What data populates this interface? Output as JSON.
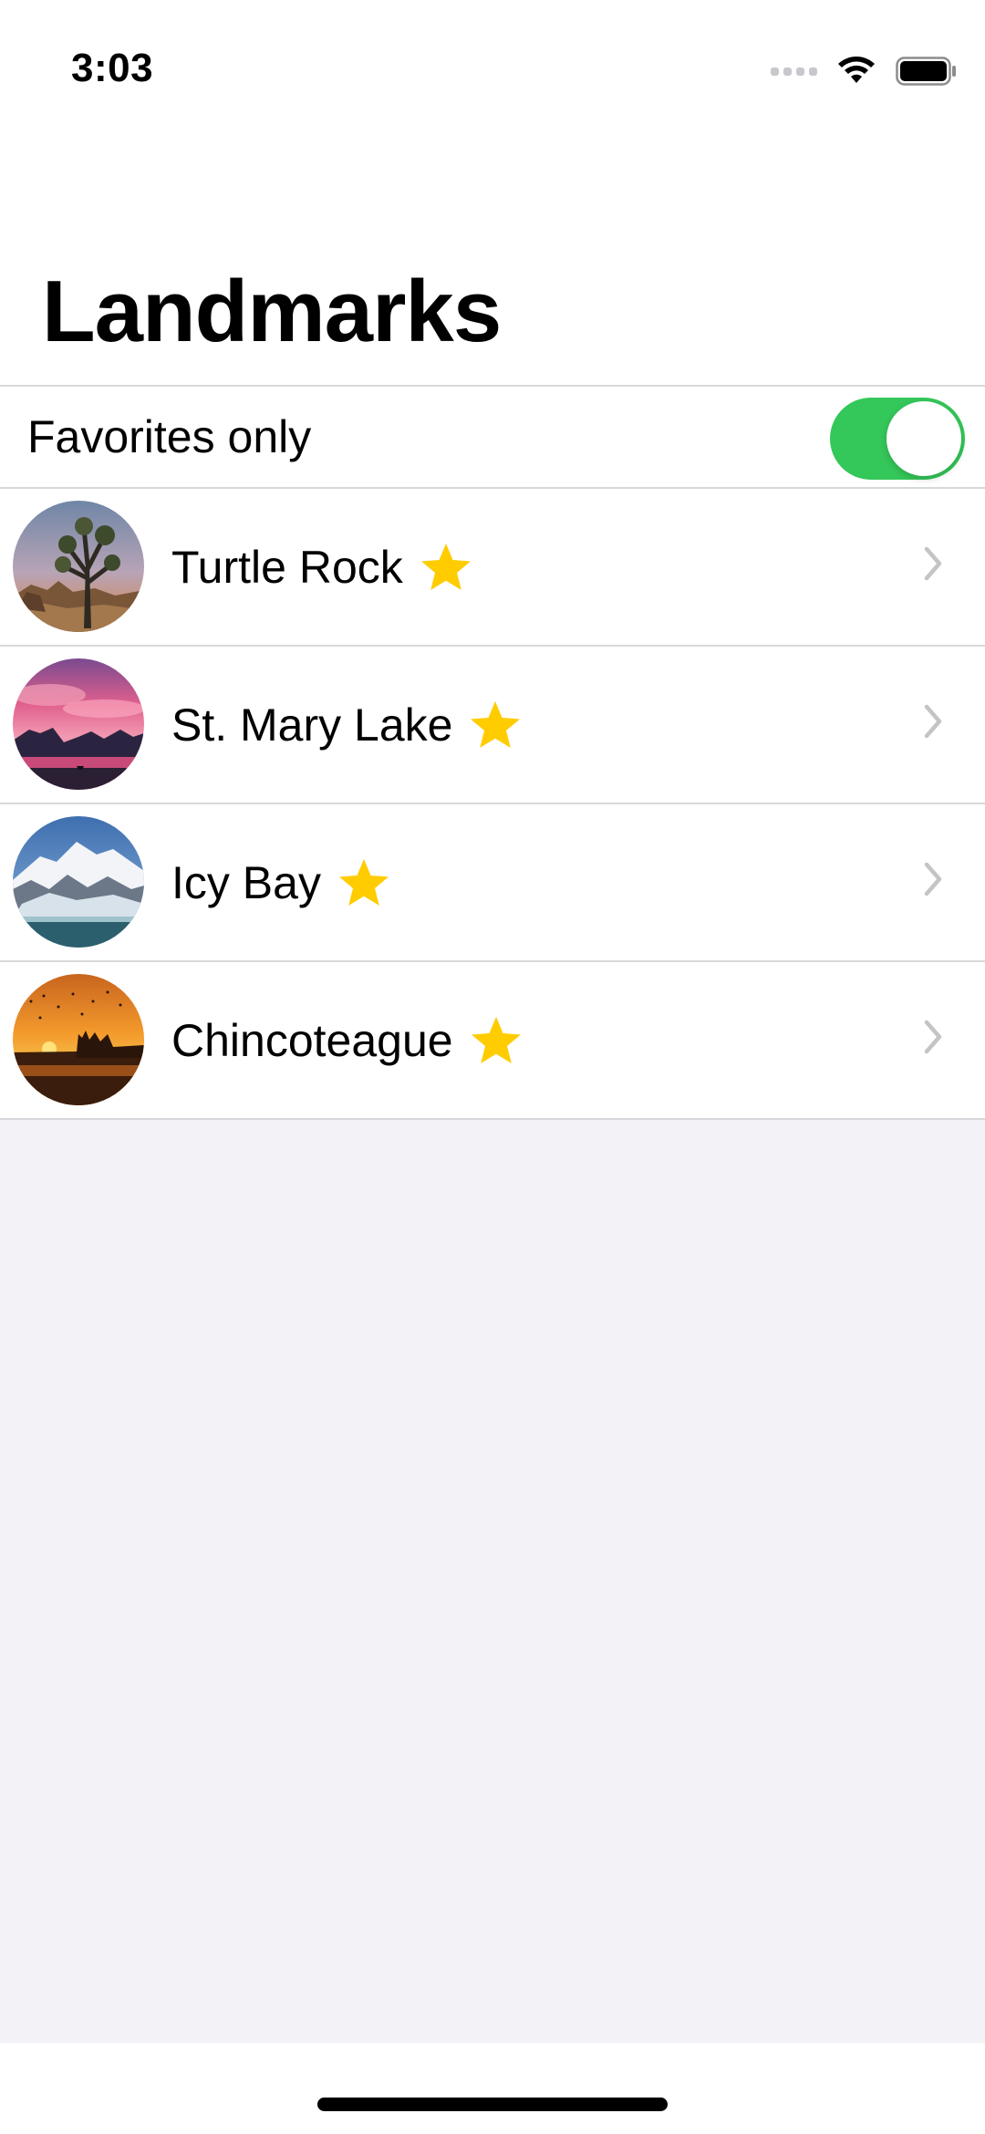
{
  "status_bar": {
    "time": "3:03",
    "icons": [
      "cellular-signal-icon",
      "wifi-icon",
      "battery-icon"
    ]
  },
  "nav": {
    "title": "Landmarks"
  },
  "filter": {
    "label": "Favorites only",
    "enabled": true,
    "toggle_color": "#34c759"
  },
  "landmarks": [
    {
      "name": "Turtle Rock",
      "favorite": true,
      "image": "joshua-tree-desert-photo"
    },
    {
      "name": "St. Mary Lake",
      "favorite": true,
      "image": "pink-sunset-lake-photo"
    },
    {
      "name": "Icy Bay",
      "favorite": true,
      "image": "snowy-mountain-glacier-photo"
    },
    {
      "name": "Chincoteague",
      "favorite": true,
      "image": "orange-sunset-marsh-photo"
    }
  ],
  "colors": {
    "star": "#ffcc00",
    "chevron": "#c4c4c7",
    "background": "#f2f2f7"
  }
}
